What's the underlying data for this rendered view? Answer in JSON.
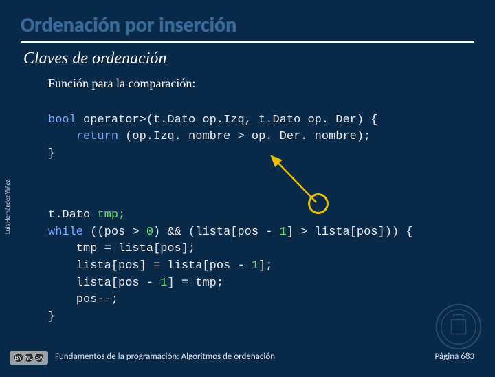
{
  "slide": {
    "title": "Ordenación por inserción",
    "subtitle": "Claves de ordenación",
    "intro": "Función para la comparación:"
  },
  "code1": {
    "l1a": "bool",
    "l1b": " operator>(t.Dato op.Izq, t.Dato op. Der) {",
    "l2a": "    return",
    "l2b": " (op.Izq. nombre > op. Der. nombre);",
    "l3": "}"
  },
  "code2": {
    "l1a": "t.Dato ",
    "l1b": "tmp;",
    "l2a": "while",
    "l2b": " ((pos > ",
    "l2c": "0",
    "l2d": ") && (lista[pos - ",
    "l2e": "1",
    "l2f": "] > lista[pos])) {",
    "l3": "    tmp = lista[pos];",
    "l4a": "    lista[pos] = lista[pos - ",
    "l4b": "1",
    "l4c": "];",
    "l5a": "    lista[pos - ",
    "l5b": "1",
    "l5c": "] = tmp;",
    "l6": "    pos--;",
    "l7": "}"
  },
  "annotation": {
    "highlight_target": "operator-greater-than",
    "arrow_color": "#e8c000"
  },
  "footer": {
    "left": "Fundamentos de la programación: Algoritmos de ordenación",
    "right": "Página 683"
  },
  "side_author": "Luis Hernández Yáñez",
  "license": {
    "type": "CC BY-NC-SA",
    "parts": [
      "BY",
      "NC",
      "SA"
    ]
  }
}
